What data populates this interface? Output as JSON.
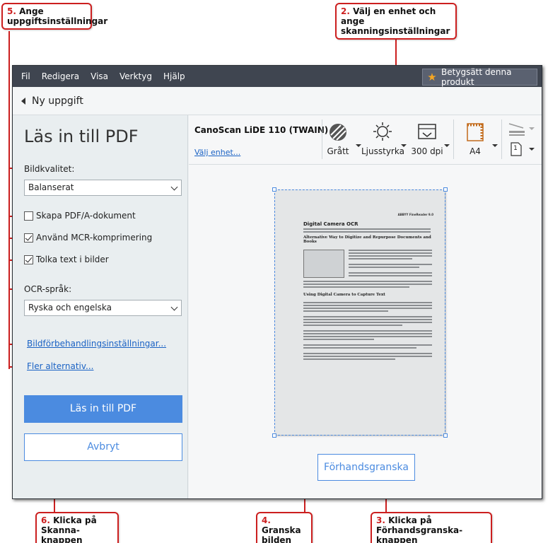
{
  "menu": [
    "Fil",
    "Redigera",
    "Visa",
    "Verktyg",
    "Hjälp"
  ],
  "rate_button": "Betygsätt denna produkt",
  "task": {
    "back_label": "Ny uppgift"
  },
  "left": {
    "title": "Läs in till PDF",
    "image_quality_label": "Bildkvalitet:",
    "image_quality_value": "Balanserat",
    "create_pdfa_label": "Skapa PDF/A-dokument",
    "mcr_label": "Använd MCR-komprimering",
    "ocr_images_label": "Tolka text i bilder",
    "ocr_lang_label": "OCR-språk:",
    "ocr_lang_value": "Ryska och engelska",
    "preprocess_link": "Bildförbehandlingsinställningar...",
    "more_link": "Fler alternativ...",
    "scan_button": "Läs in till PDF",
    "cancel_button": "Avbryt"
  },
  "toolbar": {
    "device_name": "CanoScan LiDE 110 (TWAIN)",
    "device_link": "Välj enhet...",
    "color_mode": "Grått",
    "brightness": "Ljusstyrka",
    "resolution": "300 dpi",
    "paper_size": "A4",
    "pages": "1"
  },
  "preview_button": "Förhandsgranska",
  "doc": {
    "brand": "ABBYY FineReader 9.0",
    "title": "Digital Camera OCR",
    "heading1": "Alternative Way to Digitize and Repurpose Documents and Books",
    "heading2": "Using Digital Camera to Capture Text"
  },
  "callouts": {
    "c5_num": "5.",
    "c5_text": "Ange uppgiftsinställningar",
    "c2_num": "2.",
    "c2_text": "Välj en enhet och ange skanningsinställningar",
    "c6_num": "6.",
    "c6_text": "Klicka på Skanna-knappen",
    "c4_num": "4.",
    "c4_text": "Granska bilden",
    "c3_num": "3.",
    "c3_text": "Klicka på Förhandsgranska-knappen"
  },
  "colors": {
    "accent": "#4b8be0",
    "callout_red": "#cc1f1f",
    "menubar": "#3f4550"
  }
}
